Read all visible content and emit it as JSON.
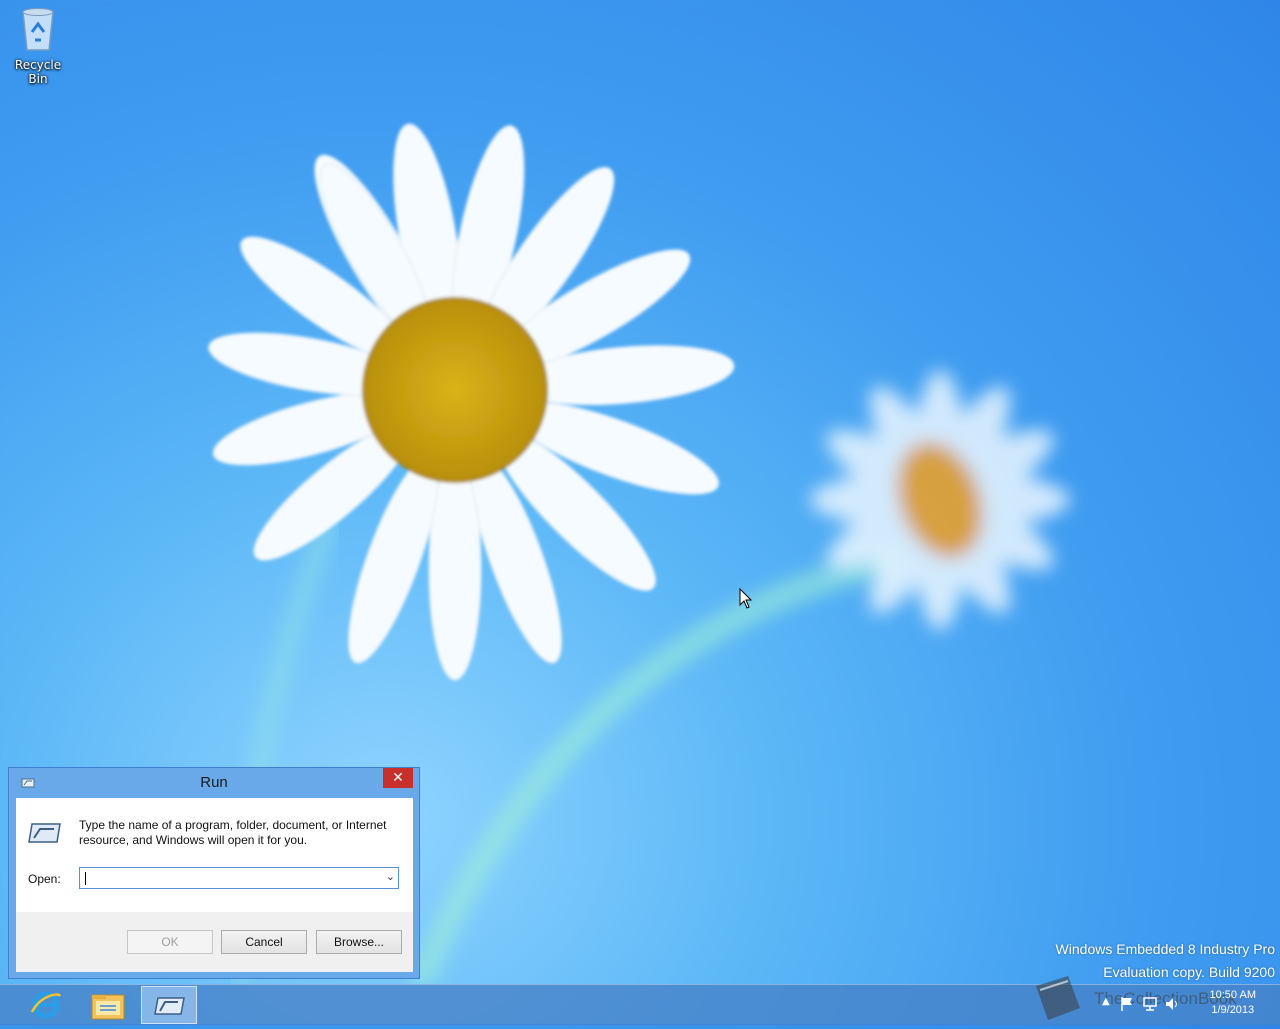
{
  "desktop": {
    "icons": [
      {
        "label": "Recycle Bin"
      }
    ]
  },
  "run_dialog": {
    "title": "Run",
    "close_glyph": "✕",
    "description": "Type the name of a program, folder, document, or Internet resource, and Windows will open it for you.",
    "open_label": "Open:",
    "open_value": "",
    "buttons": {
      "ok": "OK",
      "cancel": "Cancel",
      "browse": "Browse..."
    }
  },
  "taskbar": {
    "items": [
      {
        "icon": "internet-explorer-icon"
      },
      {
        "icon": "file-explorer-icon"
      },
      {
        "icon": "run-window-icon",
        "active": true
      }
    ],
    "clock": {
      "time": "10:50 AM",
      "date": "1/9/2013"
    }
  },
  "watermark": {
    "line1": "Windows Embedded 8 Industry Pro",
    "line2": "Evaluation copy. Build 9200"
  },
  "overlay_logo": {
    "text": "TheCollectionBook"
  },
  "colors": {
    "accent_close": "#c7302b",
    "dialog_frame": "#6aa9e9",
    "desktop": "#3f9cf0"
  }
}
